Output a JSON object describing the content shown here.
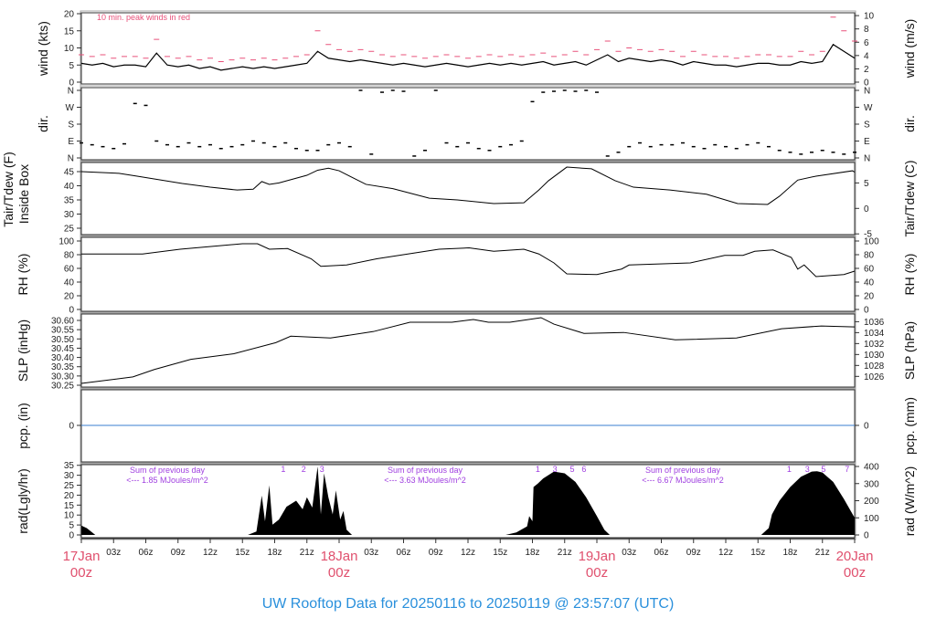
{
  "title": "UW Rooftop Data for 20250116  to  20250119 @ 23:57:07  (UTC)",
  "colors": {
    "peak": "#e8507a",
    "pcp": "#3a7fd0",
    "date": "#e0506e",
    "title": "#2a90dc",
    "annotation": "#a040e0"
  },
  "chart_data": [
    {
      "type": "line",
      "id": "wind",
      "ylabel": "wind (kts)",
      "ylabel_right": "wind (m/s)",
      "ylim": [
        0,
        20
      ],
      "yticks": [
        0,
        5,
        10,
        15,
        20
      ],
      "yticks_right": [
        0,
        2,
        4,
        6,
        8,
        10
      ],
      "annotation": "10 min. peak winds in red",
      "x_hours_step": 1,
      "series": [
        {
          "name": "mean wind",
          "values": [
            5.5,
            5,
            5.5,
            4.5,
            5,
            5,
            4.5,
            8.5,
            5,
            4.5,
            5,
            4,
            4.5,
            3.5,
            4,
            4.5,
            4,
            4.5,
            4,
            4.5,
            5,
            5.5,
            9,
            7,
            6.5,
            6,
            6.5,
            6,
            5.5,
            5,
            5.5,
            5,
            4.5,
            5,
            5.5,
            5,
            4.5,
            5,
            5.5,
            5,
            5.5,
            5,
            5.5,
            6,
            5,
            5.5,
            6,
            5,
            6.5,
            8,
            6,
            7,
            6.5,
            6,
            6.5,
            6,
            5,
            6,
            5.5,
            5,
            5,
            4.5,
            5,
            5.5,
            5.5,
            5,
            5,
            6,
            5.5,
            6,
            11,
            9,
            7
          ]
        },
        {
          "name": "10 min peak",
          "values": [
            8,
            7.5,
            8,
            7,
            7.5,
            7.5,
            7,
            12.5,
            7.5,
            7,
            7.5,
            6.5,
            7,
            6,
            6.5,
            7,
            6.5,
            7,
            6.5,
            7,
            7.5,
            8,
            15,
            11,
            9.5,
            9,
            9.5,
            9,
            8,
            7.5,
            8,
            7.5,
            7,
            7.5,
            8,
            7.5,
            7,
            7.5,
            8,
            7.5,
            8,
            7.5,
            8,
            8.5,
            7.5,
            8,
            9,
            8,
            9.5,
            12,
            9,
            10,
            9.5,
            9,
            9.5,
            9,
            7.5,
            9,
            8,
            7.5,
            7.5,
            7,
            7.5,
            8,
            8,
            7.5,
            7.5,
            9,
            8,
            9,
            19,
            15,
            12
          ]
        }
      ]
    },
    {
      "type": "scatter",
      "id": "dir",
      "ylabel": "dir.",
      "ylabel_right": "dir.",
      "yticks": [
        "N",
        "E",
        "S",
        "W",
        "N"
      ],
      "ylim": [
        0,
        360
      ],
      "x_hours_step": 1,
      "values": [
        80,
        70,
        60,
        50,
        75,
        290,
        280,
        90,
        70,
        60,
        80,
        60,
        70,
        50,
        60,
        70,
        90,
        80,
        60,
        80,
        50,
        40,
        40,
        70,
        80,
        60,
        360,
        20,
        350,
        360,
        355,
        10,
        40,
        360,
        80,
        60,
        80,
        50,
        40,
        60,
        70,
        90,
        300,
        350,
        355,
        360,
        355,
        360,
        350,
        10,
        30,
        60,
        80,
        60,
        70,
        70,
        80,
        60,
        50,
        70,
        60,
        50,
        70,
        80,
        60,
        40,
        30,
        20,
        30,
        40,
        30,
        20,
        30
      ]
    },
    {
      "type": "line",
      "id": "temp",
      "ylabel": "Tair/Tdew (F)",
      "ylabel2": "Inside Box",
      "ylabel_right": "Tair/Tdew (C)",
      "yticks": [
        25,
        30,
        35,
        40,
        45
      ],
      "yticks_right": [
        -5,
        0,
        5
      ],
      "points": [
        [
          0,
          45
        ],
        [
          3.5,
          44.4
        ],
        [
          5.2,
          43.4
        ],
        [
          9.4,
          40.8
        ],
        [
          12,
          39.5
        ],
        [
          14.5,
          38.5
        ],
        [
          16,
          38.8
        ],
        [
          16.8,
          41.5
        ],
        [
          17.5,
          40.5
        ],
        [
          18.4,
          41
        ],
        [
          21,
          43.7
        ],
        [
          22,
          45.5
        ],
        [
          23,
          46.2
        ],
        [
          24,
          45.3
        ],
        [
          26.5,
          40.5
        ],
        [
          29,
          39
        ],
        [
          32.4,
          35.6
        ],
        [
          35,
          35
        ],
        [
          38.4,
          33.7
        ],
        [
          41.2,
          34
        ],
        [
          42.6,
          38.5
        ],
        [
          43.5,
          41.8
        ],
        [
          45.2,
          46.6
        ],
        [
          47.5,
          46
        ],
        [
          49.7,
          41.8
        ],
        [
          51.4,
          39.5
        ],
        [
          54.8,
          38.5
        ],
        [
          58.2,
          37
        ],
        [
          61.1,
          33.7
        ],
        [
          63.9,
          33.4
        ],
        [
          65,
          36.3
        ],
        [
          66.7,
          42
        ],
        [
          68.4,
          43.4
        ],
        [
          71.8,
          45.3
        ],
        [
          72,
          44.8
        ]
      ]
    },
    {
      "type": "line",
      "id": "rh",
      "ylabel": "RH (%)",
      "ylabel_right": "RH (%)",
      "yticks": [
        0,
        20,
        40,
        60,
        80,
        100
      ],
      "points": [
        [
          0,
          81
        ],
        [
          5.7,
          81
        ],
        [
          9.2,
          88
        ],
        [
          15,
          96
        ],
        [
          16.4,
          96
        ],
        [
          17.5,
          88
        ],
        [
          19.2,
          89
        ],
        [
          21.4,
          74
        ],
        [
          22.3,
          63
        ],
        [
          24.7,
          65
        ],
        [
          27.5,
          74
        ],
        [
          30.4,
          81
        ],
        [
          33.3,
          88
        ],
        [
          36.1,
          90
        ],
        [
          38.4,
          85
        ],
        [
          41.2,
          88
        ],
        [
          42.6,
          81
        ],
        [
          44,
          68
        ],
        [
          45.2,
          52
        ],
        [
          48,
          51
        ],
        [
          50.3,
          59
        ],
        [
          51,
          65
        ],
        [
          56.7,
          68
        ],
        [
          59.9,
          79
        ],
        [
          61.6,
          79
        ],
        [
          62.7,
          85
        ],
        [
          64.4,
          87
        ],
        [
          66.1,
          76
        ],
        [
          66.7,
          59
        ],
        [
          67.3,
          65
        ],
        [
          68.4,
          48
        ],
        [
          71,
          51
        ],
        [
          72,
          56
        ]
      ]
    },
    {
      "type": "line",
      "id": "slp",
      "ylabel": "SLP (inHg)",
      "ylabel_right": "SLP (hPa)",
      "yticks": [
        30.25,
        30.3,
        30.35,
        30.4,
        30.45,
        30.5,
        30.55,
        30.6
      ],
      "yticks_right": [
        1026,
        1028,
        1030,
        1032,
        1034,
        1036
      ],
      "points": [
        [
          0,
          30.26
        ],
        [
          4.8,
          30.295
        ],
        [
          6.8,
          30.335
        ],
        [
          10.2,
          30.39
        ],
        [
          14.2,
          30.42
        ],
        [
          18.1,
          30.48
        ],
        [
          19.5,
          30.515
        ],
        [
          23.2,
          30.505
        ],
        [
          27.2,
          30.54
        ],
        [
          30.6,
          30.59
        ],
        [
          34.5,
          30.59
        ],
        [
          36.5,
          30.605
        ],
        [
          37.9,
          30.59
        ],
        [
          39.9,
          30.59
        ],
        [
          42.8,
          30.615
        ],
        [
          44,
          30.58
        ],
        [
          46.8,
          30.53
        ],
        [
          50.5,
          30.535
        ],
        [
          55.3,
          30.495
        ],
        [
          61,
          30.505
        ],
        [
          65.2,
          30.555
        ],
        [
          68.9,
          30.57
        ],
        [
          72,
          30.565
        ]
      ]
    },
    {
      "type": "line",
      "id": "pcp",
      "ylabel": "pcp. (in)",
      "ylabel_right": "pcp. (mm)",
      "yticks": [
        0
      ],
      "yticks_right": [
        0
      ],
      "points": [
        [
          0,
          0
        ],
        [
          72,
          0
        ]
      ]
    },
    {
      "type": "area",
      "id": "rad",
      "ylabel": "rad(Lgly/hr)",
      "ylabel_right": "rad (W/m^2)",
      "yticks": [
        0,
        5,
        10,
        15,
        20,
        25,
        30,
        35
      ],
      "yticks_right": [
        0,
        100,
        200,
        300,
        400
      ],
      "units": "W/m^2",
      "points": [
        [
          0,
          55
        ],
        [
          0.5,
          40
        ],
        [
          1.3,
          0
        ],
        [
          15.5,
          0
        ],
        [
          16.3,
          20
        ],
        [
          16.8,
          230
        ],
        [
          17.1,
          80
        ],
        [
          17.5,
          290
        ],
        [
          17.8,
          60
        ],
        [
          18.4,
          90
        ],
        [
          19.1,
          165
        ],
        [
          20,
          200
        ],
        [
          20.6,
          150
        ],
        [
          21,
          220
        ],
        [
          21.5,
          160
        ],
        [
          22,
          400
        ],
        [
          22.3,
          120
        ],
        [
          22.6,
          360
        ],
        [
          23,
          220
        ],
        [
          23.4,
          120
        ],
        [
          23.7,
          260
        ],
        [
          24.1,
          90
        ],
        [
          24.4,
          140
        ],
        [
          24.7,
          30
        ],
        [
          25.2,
          0
        ],
        [
          39.5,
          0
        ],
        [
          40.5,
          15
        ],
        [
          41.5,
          50
        ],
        [
          41.7,
          110
        ],
        [
          42,
          80
        ],
        [
          42.1,
          280
        ],
        [
          42.5,
          300
        ],
        [
          43,
          330
        ],
        [
          44,
          370
        ],
        [
          45,
          360
        ],
        [
          46,
          310
        ],
        [
          47,
          220
        ],
        [
          48,
          110
        ],
        [
          48.7,
          30
        ],
        [
          49.2,
          0
        ],
        [
          63.3,
          0
        ],
        [
          64,
          40
        ],
        [
          64.3,
          120
        ],
        [
          65,
          200
        ],
        [
          66,
          280
        ],
        [
          67,
          340
        ],
        [
          68,
          370
        ],
        [
          68.5,
          372
        ],
        [
          69,
          365
        ],
        [
          70,
          310
        ],
        [
          71,
          210
        ],
        [
          72,
          100
        ]
      ],
      "daily_sums": [
        {
          "line1": "Sum of previous day",
          "line2": "<--- 1.85 MJoules/m^2",
          "hour": 8
        },
        {
          "line1": "Sum of previous day",
          "line2": "<--- 3.63 MJoules/m^2",
          "hour": 32
        },
        {
          "line1": "Sum of previous day",
          "line2": "<--- 6.67 MJoules/m^2",
          "hour": 56
        }
      ],
      "hour_markers": [
        {
          "label": "1",
          "hour": 18.8
        },
        {
          "label": "2",
          "hour": 20.7
        },
        {
          "label": "3",
          "hour": 22.4
        },
        {
          "label": "1",
          "hour": 42.5
        },
        {
          "label": "3",
          "hour": 44.1
        },
        {
          "label": "5",
          "hour": 45.7
        },
        {
          "label": "6",
          "hour": 46.8
        },
        {
          "label": "1",
          "hour": 65.9
        },
        {
          "label": "3",
          "hour": 67.6
        },
        {
          "label": "5",
          "hour": 69.1
        },
        {
          "label": "7",
          "hour": 71.3
        }
      ]
    }
  ],
  "x_axis": {
    "hour_ticks": [
      "03z",
      "06z",
      "09z",
      "12z",
      "15z",
      "18z",
      "21z"
    ],
    "dates": [
      {
        "day": "17Jan",
        "time": "00z",
        "hour": 0
      },
      {
        "day": "18Jan",
        "time": "00z",
        "hour": 24
      },
      {
        "day": "19Jan",
        "time": "00z",
        "hour": 48
      },
      {
        "day": "20Jan",
        "time": "00z",
        "hour": 72
      }
    ]
  }
}
